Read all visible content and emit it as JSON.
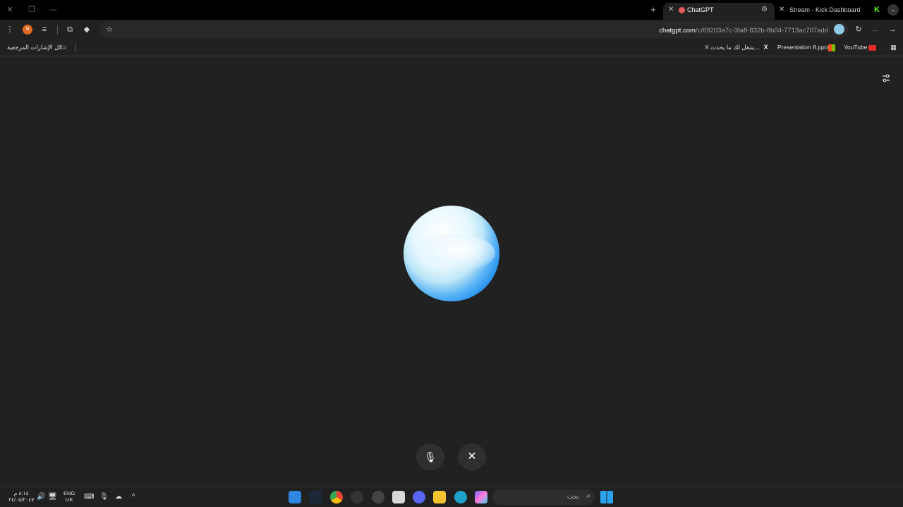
{
  "tabs": [
    {
      "label": "ChatGPT",
      "active": true
    },
    {
      "label": "Stream - Kick Dashboard",
      "active": false
    }
  ],
  "toolbar": {
    "url_host": "chatgpt.com",
    "url_path": "/c/69203a7c-3fa8-832b-8b04-7713ac707add",
    "profile_initial": "N"
  },
  "bookmarks": {
    "all_bookmarks": "كل الإشارات المرجعية",
    "items": [
      {
        "label": "YouTube"
      },
      {
        "label": "Presentation 8.pptx"
      },
      {
        "label": "X يتنقل لك ما يحدث..."
      }
    ]
  },
  "voice_controls": {
    "mic": "🎙",
    "close": "✕"
  },
  "taskbar": {
    "search_placeholder": "بحث",
    "lang_top": "ENG",
    "lang_bottom": "UK",
    "time": "٨:١٤ م",
    "date": "٢٤/٠٥/٢٠٤٧"
  },
  "colors": {
    "background": "#212121",
    "orb_blue": "#1d8cf0",
    "tab_close": "#bbbbbb"
  }
}
